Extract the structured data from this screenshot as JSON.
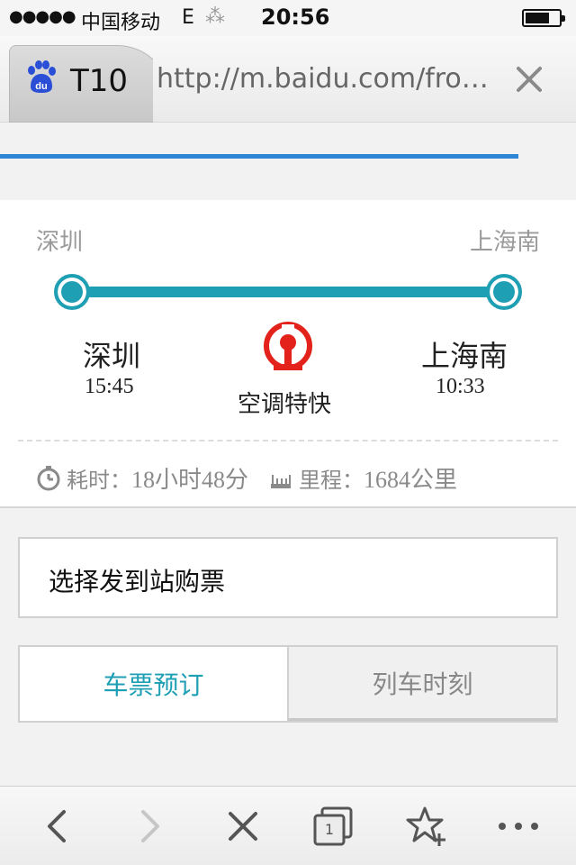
{
  "status_bar": {
    "signal": "●●●●●",
    "carrier": "中国移动",
    "network": "E",
    "activity": "⁂",
    "time": "20:56"
  },
  "browser": {
    "tab_title": "T10",
    "url": "http://m.baidu.com/fro…"
  },
  "route": {
    "header_from": "深圳",
    "header_to": "上海南",
    "from_station": "深圳",
    "from_time": "15:45",
    "to_station": "上海南",
    "to_time": "10:33",
    "train_type": "空调特快",
    "duration_label": "耗时：",
    "duration_value": "18小时48分",
    "distance_label": "里程：",
    "distance_value": "1684公里"
  },
  "actions": {
    "select_station": "选择发到站购票",
    "tab_booking": "车票预订",
    "tab_schedule": "列车时刻"
  },
  "toolbar": {
    "tab_count": "1"
  },
  "colors": {
    "accent": "#1f9fb4",
    "rail_red": "#e3231b",
    "progress_blue": "#2f86d6"
  }
}
